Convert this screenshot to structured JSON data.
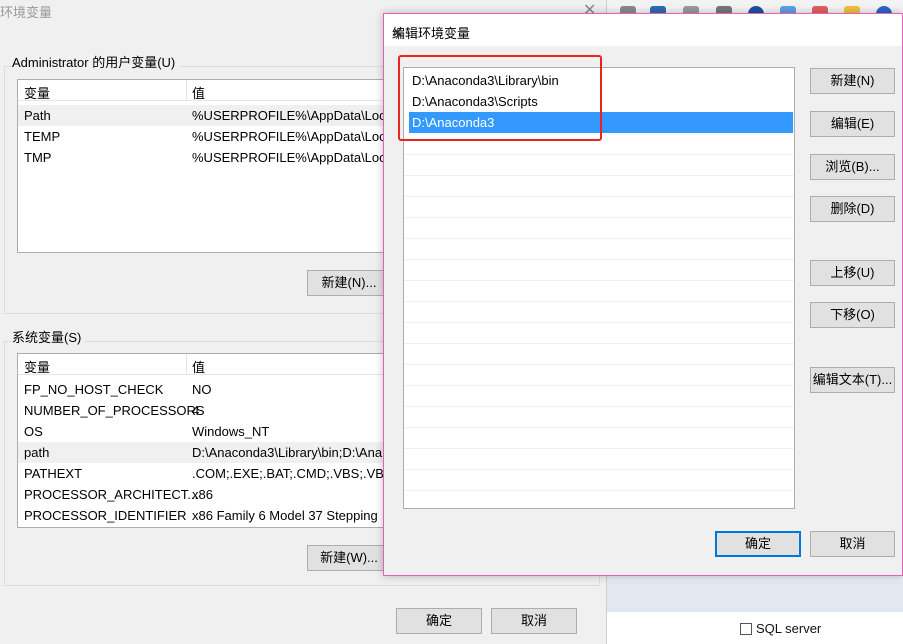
{
  "main_dialog": {
    "title": "环境变量",
    "user_group_label": "Administrator 的用户变量(U)",
    "user_columns": [
      "变量",
      "值"
    ],
    "user_vars": [
      {
        "name": "Path",
        "value": "%USERPROFILE%\\AppData\\Local"
      },
      {
        "name": "TEMP",
        "value": "%USERPROFILE%\\AppData\\Local"
      },
      {
        "name": "TMP",
        "value": "%USERPROFILE%\\AppData\\Local"
      }
    ],
    "user_new_button": "新建(N)...",
    "system_group_label": "系统变量(S)",
    "system_columns": [
      "变量",
      "值"
    ],
    "system_vars": [
      {
        "name": "FP_NO_HOST_CHECK",
        "value": "NO"
      },
      {
        "name": "NUMBER_OF_PROCESSORS",
        "value": "4"
      },
      {
        "name": "OS",
        "value": "Windows_NT"
      },
      {
        "name": "path",
        "value": "D:\\Anaconda3\\Library\\bin;D:\\Ana"
      },
      {
        "name": "PATHEXT",
        "value": ".COM;.EXE;.BAT;.CMD;.VBS;.VBE;."
      },
      {
        "name": "PROCESSOR_ARCHITECT...",
        "value": "x86"
      },
      {
        "name": "PROCESSOR_IDENTIFIER",
        "value": "x86 Family 6 Model 37 Stepping"
      }
    ],
    "system_new_button": "新建(W)...",
    "ok_button": "确定",
    "cancel_button": "取消"
  },
  "edit_dialog": {
    "title": "编辑环境变量",
    "close_icon": "close-icon",
    "paths": [
      "D:\\Anaconda3\\Library\\bin",
      "D:\\Anaconda3\\Scripts",
      "D:\\Anaconda3"
    ],
    "selected_index": 2,
    "buttons": {
      "new": "新建(N)",
      "edit": "编辑(E)",
      "browse": "浏览(B)...",
      "delete": "删除(D)",
      "move_up": "上移(U)",
      "move_down": "下移(O)",
      "edit_text": "编辑文本(T)...",
      "ok": "确定",
      "cancel": "取消"
    }
  },
  "background": {
    "sql_server_label": "SQL server"
  },
  "colors": {
    "selection": "#3399ff",
    "highlight_box": "#e8251f",
    "edit_dialog_border": "#e75fb6",
    "default_button_border": "#0078d7"
  }
}
